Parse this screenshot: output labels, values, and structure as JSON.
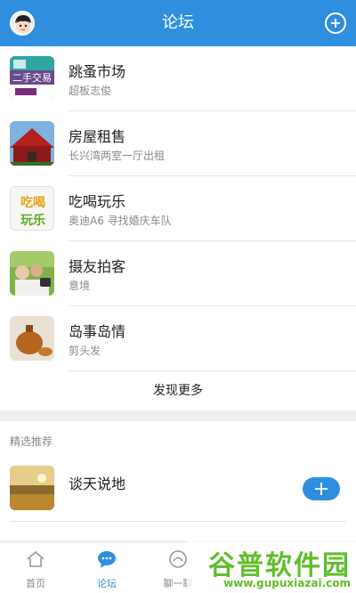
{
  "header": {
    "title": "论坛"
  },
  "forums": [
    {
      "name": "跳蚤市场",
      "sub": "超板志俊",
      "thumb": "second-hand-trade-thumb",
      "thumb_text": "二手交易"
    },
    {
      "name": "房屋租售",
      "sub": "长兴湾两室一厅出租",
      "thumb": "red-house-thumb"
    },
    {
      "name": "吃喝玩乐",
      "sub": "奥迪A6 寻找婚庆车队",
      "thumb": "eat-drink-play-thumb",
      "thumb_text": "吃喝玩乐"
    },
    {
      "name": "摄友拍客",
      "sub": "意境",
      "thumb": "photographers-thumb"
    },
    {
      "name": "岛事岛情",
      "sub": "剪头发",
      "thumb": "island-thumb"
    }
  ],
  "more_label": "发现更多",
  "featured": {
    "section_label": "精选推荐",
    "item": {
      "name": "谈天说地",
      "thumb": "landscape-thumb"
    }
  },
  "tabs": [
    {
      "label": "首页",
      "icon": "home-icon",
      "active": false
    },
    {
      "label": "论坛",
      "icon": "chat-bubble-icon",
      "active": true
    },
    {
      "label": "聊一聊",
      "icon": "chat-icon",
      "active": false
    }
  ],
  "watermark": {
    "big": "谷普软件园",
    "small": "www.gupuxiazai.com"
  },
  "colors": {
    "accent": "#2f8fde",
    "watermark": "#5fbf2a"
  }
}
